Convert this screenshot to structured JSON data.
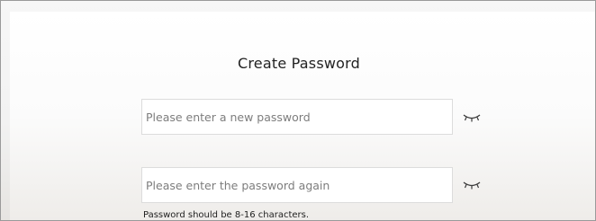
{
  "dialog": {
    "title": "Create Password",
    "new_password": {
      "value": "",
      "placeholder": "Please enter a new password"
    },
    "confirm_password": {
      "value": "",
      "placeholder": "Please enter the password again"
    },
    "hint": "Password should be 8-16 characters.",
    "icons": {
      "toggle_new": "eye-closed-icon",
      "toggle_confirm": "eye-closed-icon"
    }
  }
}
